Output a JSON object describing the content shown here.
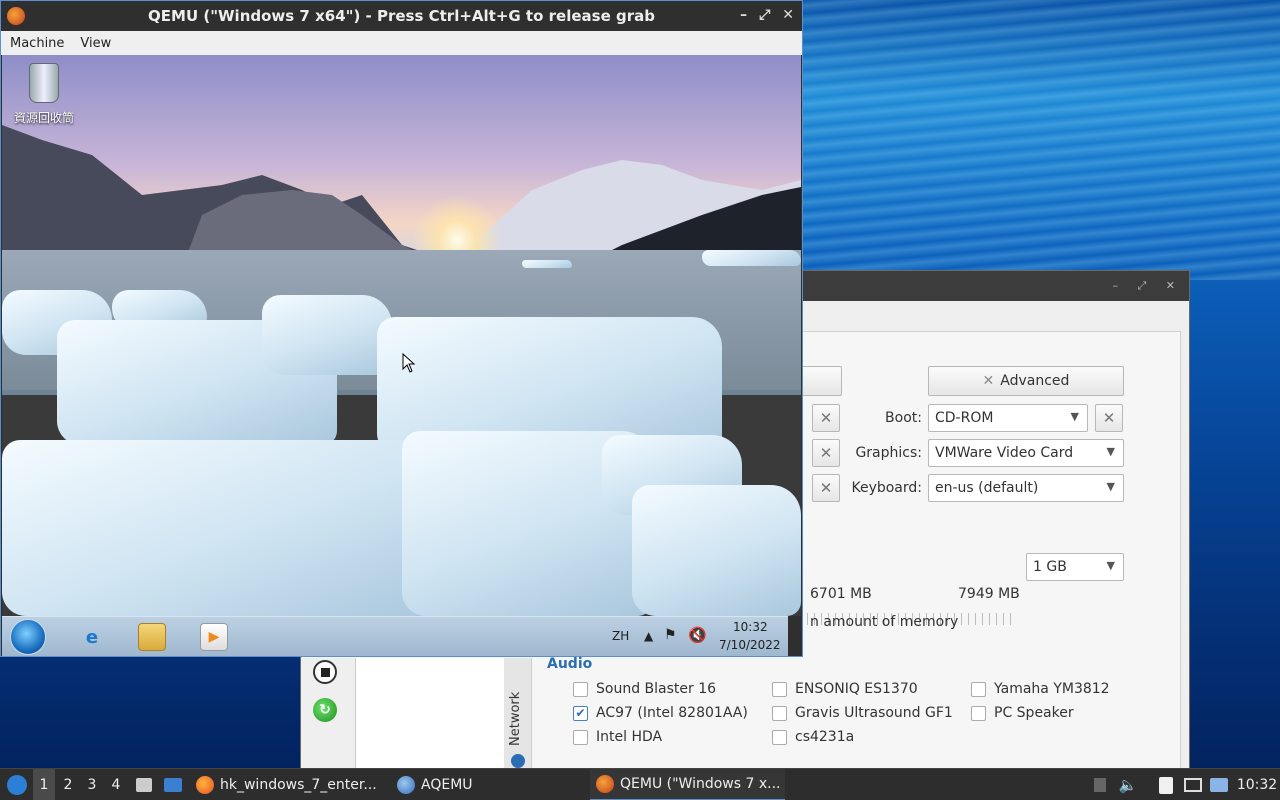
{
  "qemu_window": {
    "title": "QEMU (\"Windows 7 x64\") - Press Ctrl+Alt+G to release grab",
    "controls": [
      "–",
      "⤢",
      "✕"
    ],
    "menu": [
      "Machine",
      "View"
    ]
  },
  "guest_desktop": {
    "recycle_bin_label": "資源回收筒",
    "taskbar": {
      "language": "ZH",
      "time": "10:32",
      "date": "7/10/2022",
      "pinned_icons": [
        "ie-icon",
        "explorer-icon",
        "media-player-icon"
      ]
    }
  },
  "aqemu_panel": {
    "advanced_label": "Advanced",
    "boot_label": "Boot:",
    "boot_value": "CD-ROM",
    "graphics_label": "Graphics:",
    "graphics_value": "VMWare Video Card",
    "keyboard_label": "Keyboard:",
    "keyboard_value": "en-us (default)",
    "memory_value": "1 GB",
    "memory_free": "6701 MB",
    "memory_total": "7949 MB",
    "memory_note": "n amount of memory",
    "network_tab": "Network",
    "audio_title": "Audio",
    "audio_options": [
      {
        "label": "Sound Blaster 16",
        "checked": false
      },
      {
        "label": "ENSONIQ ES1370",
        "checked": false
      },
      {
        "label": "Yamaha YM3812",
        "checked": false
      },
      {
        "label": "AC97 (Intel 82801AA)",
        "checked": true
      },
      {
        "label": "Gravis Ultrasound GF1",
        "checked": false
      },
      {
        "label": "PC Speaker",
        "checked": false
      },
      {
        "label": "Intel HDA",
        "checked": false
      },
      {
        "label": "cs4231a",
        "checked": false
      }
    ]
  },
  "panel": {
    "workspaces": [
      "1",
      "2",
      "3",
      "4"
    ],
    "tasks": [
      {
        "label": "hk_windows_7_enter...",
        "icon": "firefox-icon"
      },
      {
        "label": "AQEMU",
        "icon": "aqemu-icon"
      },
      {
        "label": "QEMU (\"Windows 7 x...",
        "icon": "qemu-icon"
      }
    ],
    "clock": "10:32"
  }
}
